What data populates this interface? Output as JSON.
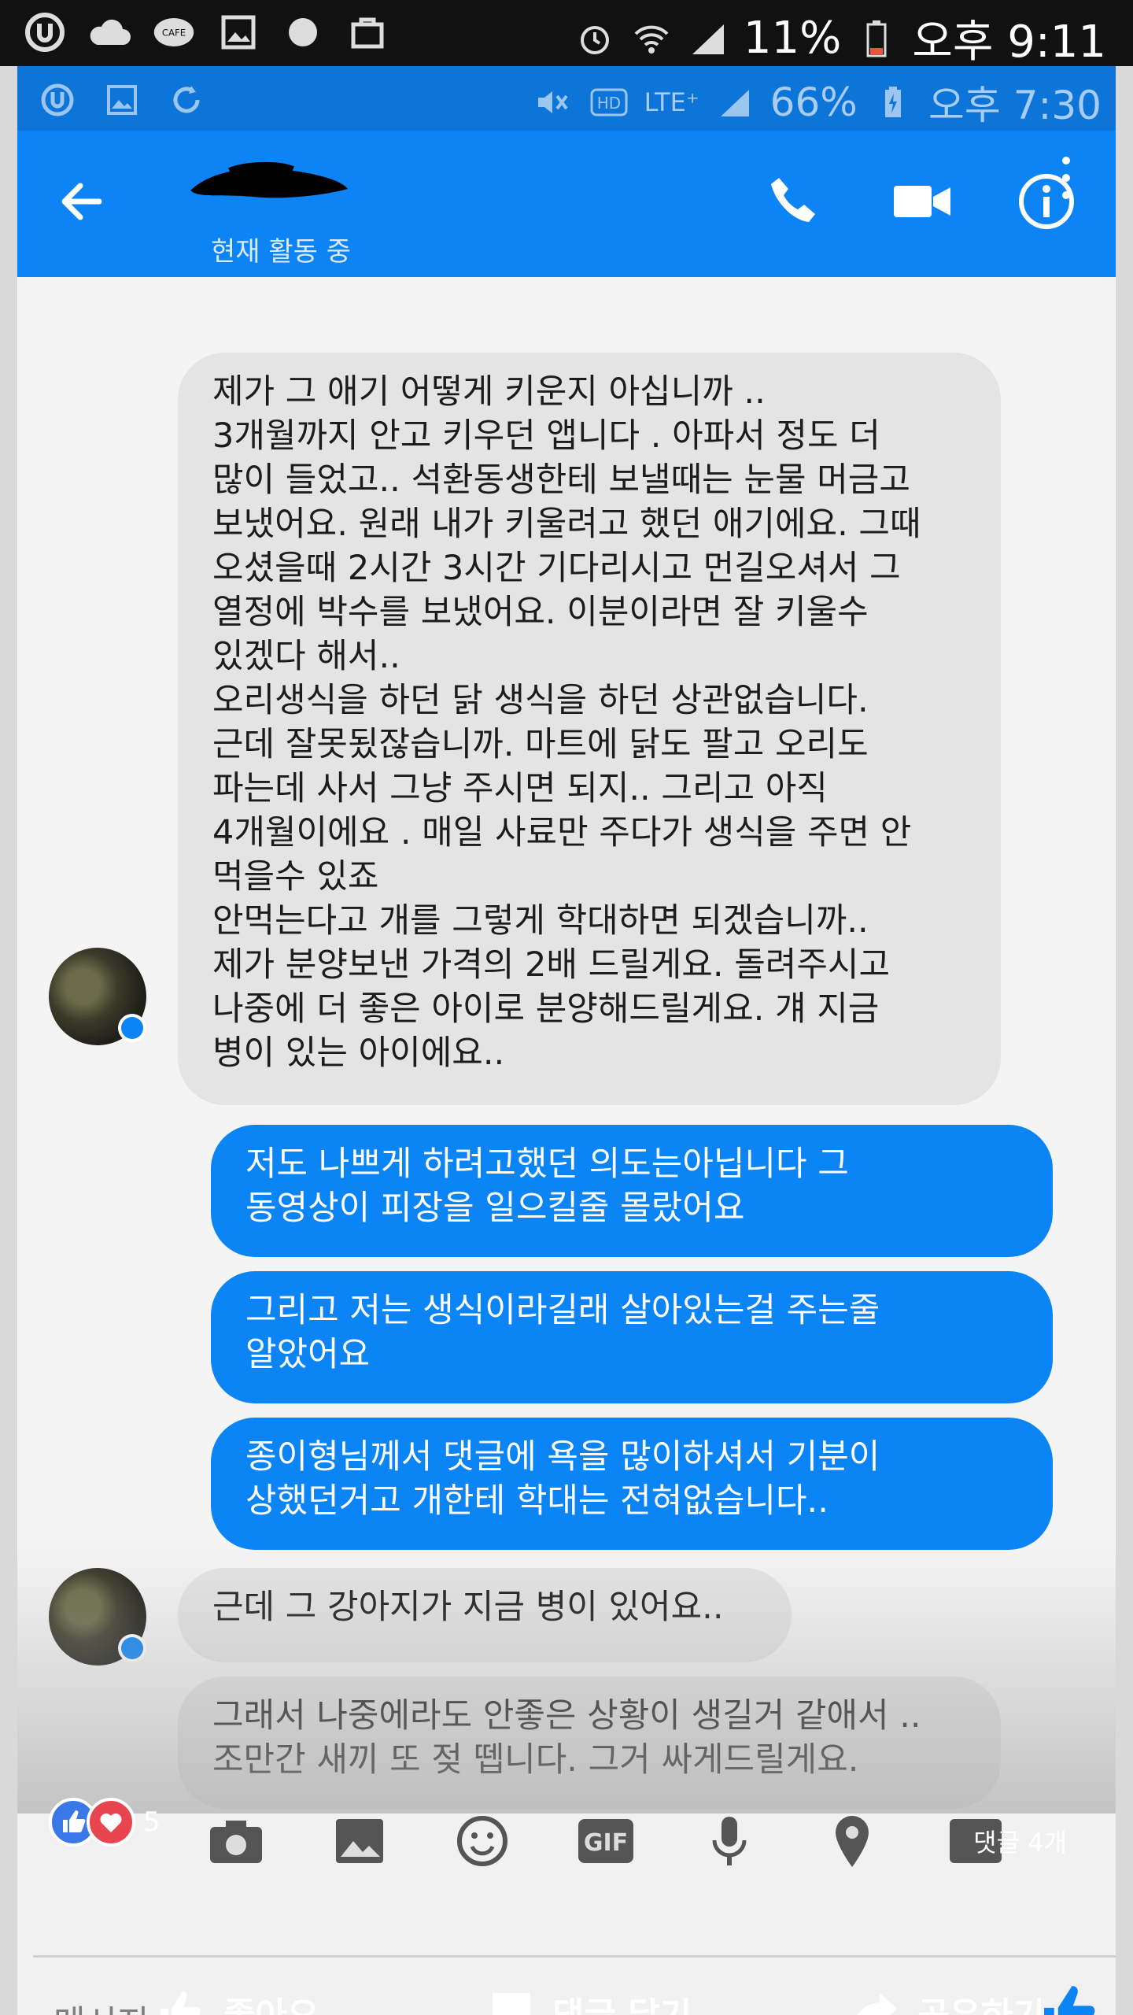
{
  "outer_status": {
    "battery": "11%",
    "time": "오후 9:11",
    "icons": [
      "app-logo-icon",
      "cloud-icon",
      "cafe-icon",
      "gallery-icon",
      "circle-icon",
      "bag-icon",
      "alarm-icon",
      "wifi-icon",
      "signal-icon",
      "battery-icon"
    ]
  },
  "inner_status": {
    "network": "LTE⁺",
    "battery": "66%",
    "time": "오후 7:30"
  },
  "header": {
    "active_status": "현재 활동 중"
  },
  "messages": [
    {
      "side": "in",
      "text": "제가 그 애기 어떻게 키운지 아십니까 ..\n3개월까지 안고 키우던 앱니다 . 아파서 정도 더\n많이 들었고.. 석환동생한테 보낼때는 눈물 머금고\n보냈어요. 원래 내가 키울려고 했던 애기에요.  그때\n오셨을때 2시간 3시간 기다리시고 먼길오셔서  그\n열정에 박수를 보냈어요. 이분이라면 잘 키울수\n있겠다 해서..\n오리생식을 하던 닭 생식을 하던 상관없습니다.\n근데 잘못됬잖습니까. 마트에 닭도 팔고 오리도\n파는데 사서 그냥 주시면 되지..  그리고 아직\n4개월이에요 . 매일 사료만 주다가 생식을 주면 안\n먹을수 있죠\n안먹는다고 개를 그렇게 학대하면 되겠습니까..\n제가 분양보낸 가격의 2배 드릴게요. 돌려주시고\n나중에 더 좋은 아이로 분양해드릴게요. 걔 지금\n병이 있는 아이에요.."
    },
    {
      "side": "out",
      "text": "저도 나쁘게 하려고했던 의도는아닙니다 그\n동영상이 피장을 일으킬줄 몰랐어요"
    },
    {
      "side": "out",
      "text": "그리고 저는 생식이라길래 살아있는걸 주는줄\n알았어요"
    },
    {
      "side": "out",
      "text": "종이형님께서 댓글에 욕을 많이하셔서 기분이\n상했던거고 개한테 학대는 전혀없습니다.."
    },
    {
      "side": "in",
      "text": "근데 그 강아지가 지금 병이 있어요.."
    },
    {
      "side": "in",
      "text": "그래서 나중에라도 안좋은 상황이 생길거 같애서 ..\n조만간 새끼 또 젖 뗍니다. 그거 싸게드릴게요."
    }
  ],
  "social": {
    "reaction_count": "5",
    "comment_count": "댓글 4개",
    "composer_placeholder": "메시지",
    "like_label": "좋아요",
    "comment_label": "댓글 달기",
    "share_label": "공유하기"
  },
  "colors": {
    "header_blue": "#0c84f5",
    "outgoing_bubble": "#0b84f6",
    "incoming_bubble": "#e4e4e4"
  }
}
